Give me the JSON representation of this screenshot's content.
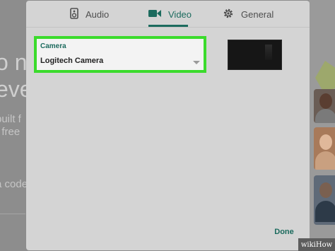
{
  "dialog": {
    "tabs": [
      {
        "label": "Audio",
        "icon": "speaker-icon",
        "active": false
      },
      {
        "label": "Video",
        "icon": "video-camera-icon",
        "active": true
      },
      {
        "label": "General",
        "icon": "gear-icon",
        "active": false
      }
    ],
    "camera": {
      "label": "Camera",
      "selected": "Logitech Camera"
    },
    "done_label": "Done"
  },
  "background": {
    "line1": "o n",
    "line2": "eve",
    "line3": "built f",
    "line4": "t free",
    "line5": "a code"
  },
  "watermark": "wikiHow",
  "colors": {
    "accent": "#1c6b5e",
    "highlight": "#3bdb2c",
    "dialog_bg": "#d4d4d4"
  }
}
